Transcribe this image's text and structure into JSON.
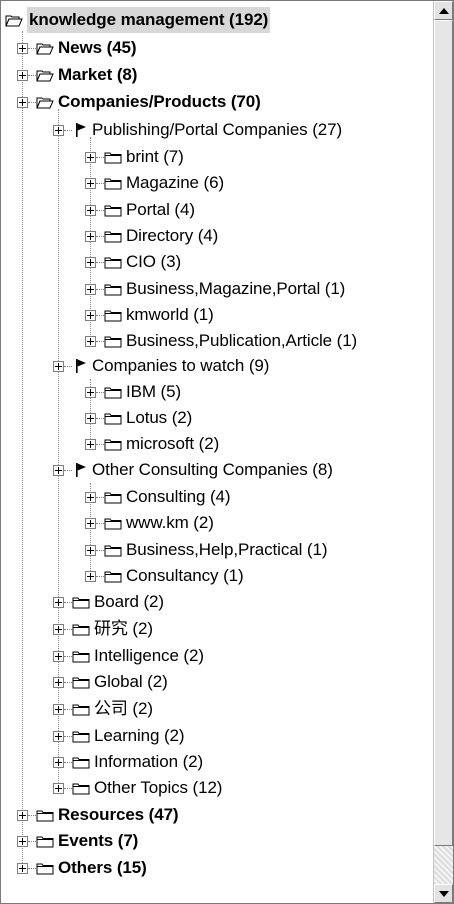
{
  "tree": {
    "root": "knowledge management (192)",
    "items": [
      {
        "label": "News (45)"
      },
      {
        "label": "Market (8)"
      },
      {
        "label": "Companies/Products (70)"
      },
      {
        "label": "Publishing/Portal Companies (27)"
      },
      {
        "label": "brint (7)"
      },
      {
        "label": "Magazine (6)"
      },
      {
        "label": "Portal (4)"
      },
      {
        "label": "Directory (4)"
      },
      {
        "label": "CIO (3)"
      },
      {
        "label": "Business,Magazine,Portal (1)"
      },
      {
        "label": "kmworld (1)"
      },
      {
        "label": "Business,Publication,Article (1)"
      },
      {
        "label": "Companies to watch (9)"
      },
      {
        "label": "IBM (5)"
      },
      {
        "label": "Lotus (2)"
      },
      {
        "label": "microsoft (2)"
      },
      {
        "label": "Other Consulting Companies (8)"
      },
      {
        "label": "Consulting (4)"
      },
      {
        "label": "www.km (2)"
      },
      {
        "label": "Business,Help,Practical (1)"
      },
      {
        "label": "Consultancy (1)"
      },
      {
        "label": "Board (2)"
      },
      {
        "label": "研究 (2)"
      },
      {
        "label": "Intelligence (2)"
      },
      {
        "label": "Global (2)"
      },
      {
        "label": "公司 (2)"
      },
      {
        "label": "Learning (2)"
      },
      {
        "label": "Information (2)"
      },
      {
        "label": "Other Topics (12)"
      },
      {
        "label": "Resources (47)"
      },
      {
        "label": "Events (7)"
      },
      {
        "label": "Others (15)"
      }
    ]
  },
  "icons": {
    "root": "open-folder-icon",
    "folder": "folder-icon",
    "flag": "flag-icon",
    "expander": "plus-expander-icon"
  },
  "colors": {
    "root_highlight": "#d8d8d8",
    "scrollbar": "#e2e2e2"
  }
}
